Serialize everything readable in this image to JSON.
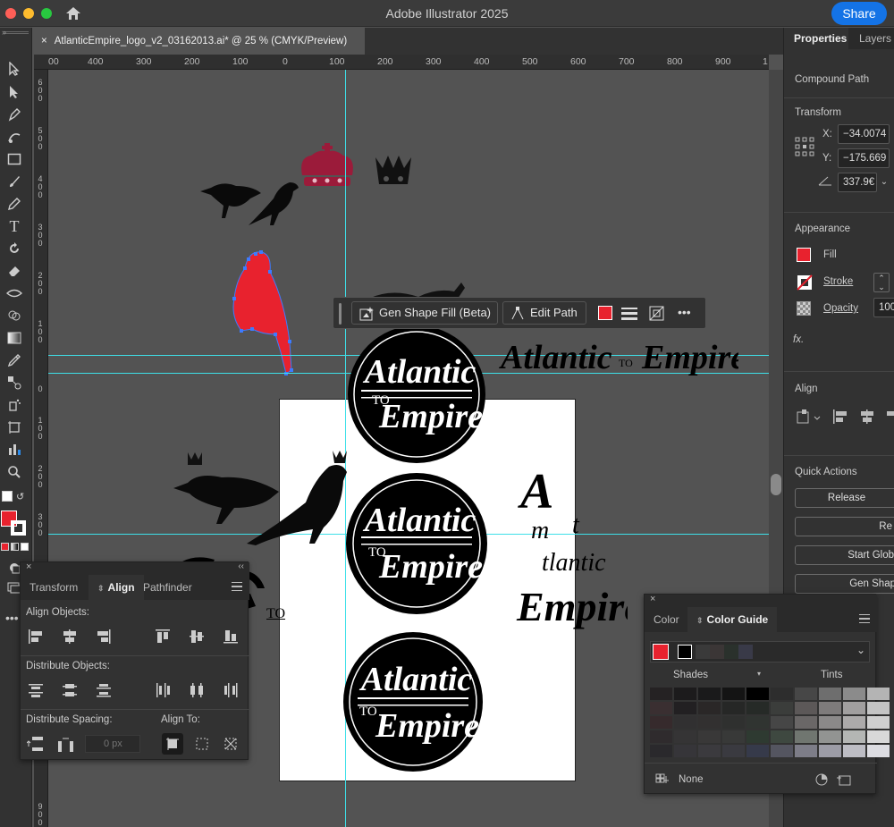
{
  "window": {
    "app_title": "Adobe Illustrator 2025",
    "share_label": "Share",
    "colors": {
      "close": "#fe5f57",
      "minimize": "#febc2e",
      "maximize": "#28c840",
      "accent": "#1473e6"
    }
  },
  "document": {
    "tab_title": "AtlanticEmpire_logo_v2_03162013.ai* @ 25 % (CMYK/Preview)",
    "close_symbol": "×"
  },
  "rulers": {
    "top": [
      "00",
      "400",
      "300",
      "200",
      "100",
      "0",
      "100",
      "200",
      "300",
      "400",
      "500",
      "600",
      "700",
      "800",
      "900",
      "1"
    ],
    "left": [
      "6\n0\n0",
      "5\n0\n0",
      "4\n0\n0",
      "3\n0\n0",
      "2\n0\n0",
      "1\n0\n0",
      "0",
      "1\n0\n0",
      "2\n0\n0",
      "3\n0\n0",
      "9\n0\n0"
    ]
  },
  "toolbar": {
    "tools": [
      "selection-icon",
      "direct-selection-icon",
      "pen-icon",
      "curvature-icon",
      "rectangle-icon",
      "paintbrush-icon",
      "pencil-icon",
      "type-icon",
      "rotate-icon",
      "eraser-icon",
      "width-icon",
      "shape-builder-icon",
      "gradient-icon",
      "eyedropper-icon",
      "blend-icon",
      "symbol-sprayer-icon",
      "artboard-icon",
      "column-graph-icon",
      "zoom-icon"
    ],
    "more": "•••"
  },
  "context_bar": {
    "gen_shape_fill": "Gen Shape Fill (Beta)",
    "edit_path": "Edit Path",
    "fill_color": "#e8222e",
    "more": "•••"
  },
  "artwork": {
    "logo_top_line": "Atlantic",
    "logo_to": "TO",
    "logo_bottom_line": "Empire",
    "wordmark": "Atlantic",
    "wordmark_to": "TO",
    "wordmark_end": "Empire",
    "vertical_a": "A",
    "vertical_m": "m",
    "vertical_t": "t",
    "vertical_tlantic": "tlantic",
    "vertical_empire": "Empire",
    "stray_to": "TO",
    "bird_color": "#e8222e",
    "crown_color": "#9b1b3a"
  },
  "properties": {
    "tabs": [
      "Properties",
      "Layers"
    ],
    "selection_type": "Compound Path",
    "transform_title": "Transform",
    "x_label": "X:",
    "x_value": "−34.0074",
    "y_label": "Y:",
    "y_value": "−175.669",
    "angle_value": "337.9€",
    "appearance_title": "Appearance",
    "fill_label": "Fill",
    "stroke_label": "Stroke",
    "opacity_label": "Opacity",
    "opacity_value": "100",
    "fx": "fx.",
    "align_title": "Align",
    "quick_actions_title": "Quick Actions",
    "release": "Release",
    "re": "Re",
    "start_global": "Start Glob",
    "gen_shape": "Gen Shap"
  },
  "align_panel": {
    "tabs": [
      "Transform",
      "Align",
      "Pathfinder"
    ],
    "align_objects": "Align Objects:",
    "distribute_objects": "Distribute Objects:",
    "distribute_spacing": "Distribute Spacing:",
    "align_to": "Align To:",
    "spacing_placeholder": "0 px"
  },
  "color_panel": {
    "tabs": [
      "Color",
      "Color Guide"
    ],
    "shades": "Shades",
    "tints": "Tints",
    "none_label": "None",
    "base_colors": [
      "#e8222e",
      "#000000",
      "#3a3a3a",
      "#3b3636",
      "#2a312c",
      "#393a48"
    ],
    "grid": [
      [
        "#252223",
        "#1c1b1c",
        "#1a1a1b",
        "#141414",
        "#000000",
        "#2d2d2d",
        "#474747",
        "#6e6e6e",
        "#8b8b8b",
        "#b4b4b4"
      ],
      [
        "#3a2f31",
        "#222022",
        "#2a2727",
        "#262726",
        "#262a27",
        "#3b3d3b",
        "#5c5858",
        "#7e7b7b",
        "#a19f9f",
        "#c4c4c4"
      ],
      [
        "#362a2c",
        "#313031",
        "#323030",
        "#2f302f",
        "#303431",
        "#464646",
        "#6a6767",
        "#8b8989",
        "#acaaaa",
        "#cfcfcf"
      ],
      [
        "#2f2b2d",
        "#353435",
        "#393838",
        "#383938",
        "#2e3a31",
        "#3e4840",
        "#707670",
        "#929492",
        "#b4b6b4",
        "#d8d8d8"
      ],
      [
        "#2a292c",
        "#363539",
        "#3b3a3e",
        "#3a3a40",
        "#363a4a",
        "#545560",
        "#7d7d88",
        "#9c9ca6",
        "#bdbdc4",
        "#dddde2"
      ]
    ]
  }
}
